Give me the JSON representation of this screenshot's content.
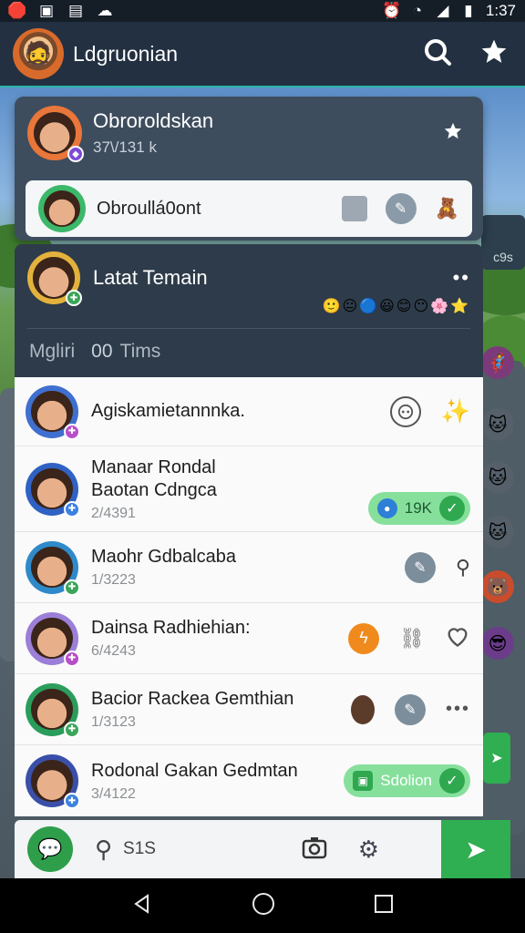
{
  "status_bar": {
    "time": "1:37"
  },
  "app_bar": {
    "title": "Ldgruonian"
  },
  "notification": {
    "name": "Obroroldskan",
    "subtitle": "37\\/131 k",
    "row_label": "Obroullá0ont"
  },
  "team": {
    "name": "Latat Temain",
    "filter_label": "Mgliri",
    "filter_count": "00",
    "filter_unit": "Tims"
  },
  "rows": [
    {
      "name": "Agiskamietannnka.",
      "meta": ""
    },
    {
      "name": "Manaar Rondal\nBaotan Cdngca",
      "meta": "2/4391",
      "pill": "19K"
    },
    {
      "name": "Maohr Gdbalcaba",
      "meta": "1/3223"
    },
    {
      "name": "Dainsa Radhiehian:",
      "meta": "6/4243"
    },
    {
      "name": "Bacior Rackea Gemthian",
      "meta": "1/3123"
    },
    {
      "name": "Rodonal Gakan Gedmtan",
      "meta": "3/4122",
      "pill": "Sdolion"
    }
  ],
  "composer": {
    "count": "S1S"
  },
  "colors": {
    "accent": "#2bb3a6",
    "green": "#2fae52",
    "panel": "#2e3b4a"
  }
}
